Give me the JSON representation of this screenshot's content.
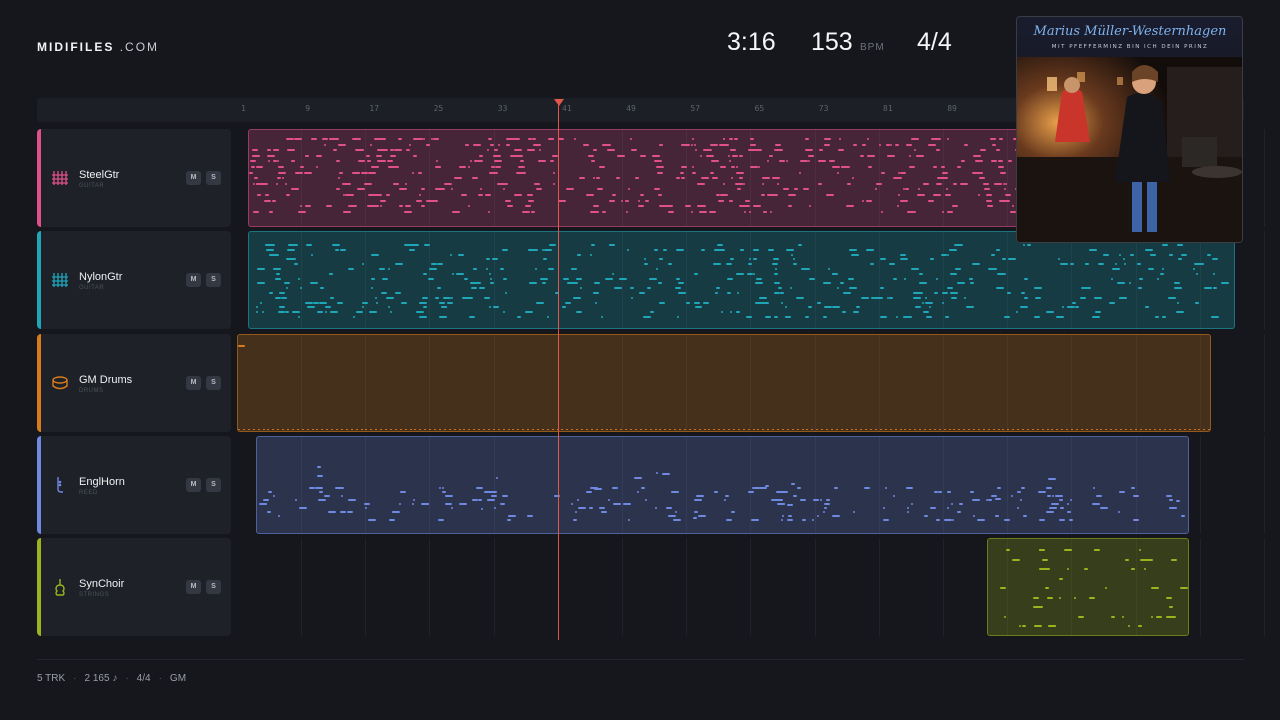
{
  "header": {
    "logo_bold": "MIDIFILES",
    "logo_light": ".COM",
    "duration": "3:16",
    "tempo": "153",
    "tempo_unit": "BPM",
    "time_signature": "4/4"
  },
  "ruler": {
    "bars": [
      "1",
      "9",
      "17",
      "25",
      "33",
      "41",
      "49",
      "57",
      "65",
      "73",
      "81",
      "89"
    ]
  },
  "tracks": [
    {
      "name": "SteelGtr",
      "category": "GUITAR",
      "color": "#e0508a",
      "icon": "guitar-fretboard-icon",
      "mute": "M",
      "solo": "S"
    },
    {
      "name": "NylonGtr",
      "category": "GUITAR",
      "color": "#1fa6b8",
      "icon": "guitar-fretboard-icon",
      "mute": "M",
      "solo": "S"
    },
    {
      "name": "GM Drums",
      "category": "DRUMS",
      "color": "#d97b1c",
      "icon": "drum-icon",
      "mute": "M",
      "solo": "S"
    },
    {
      "name": "EnglHorn",
      "category": "REED",
      "color": "#6f88e0",
      "icon": "reed-icon",
      "mute": "M",
      "solo": "S"
    },
    {
      "name": "SynChoir",
      "category": "STRINGS",
      "color": "#9bb31c",
      "icon": "violin-icon",
      "mute": "M",
      "solo": "S"
    }
  ],
  "album": {
    "artist": "Marius Müller-Westernhagen",
    "title": "MIT PFEFFERMINZ BIN ICH DEIN PRINZ"
  },
  "footer": {
    "tracks": "5 TRK",
    "notes": "2 165 ♪",
    "signature": "4/4",
    "standard": "GM"
  }
}
